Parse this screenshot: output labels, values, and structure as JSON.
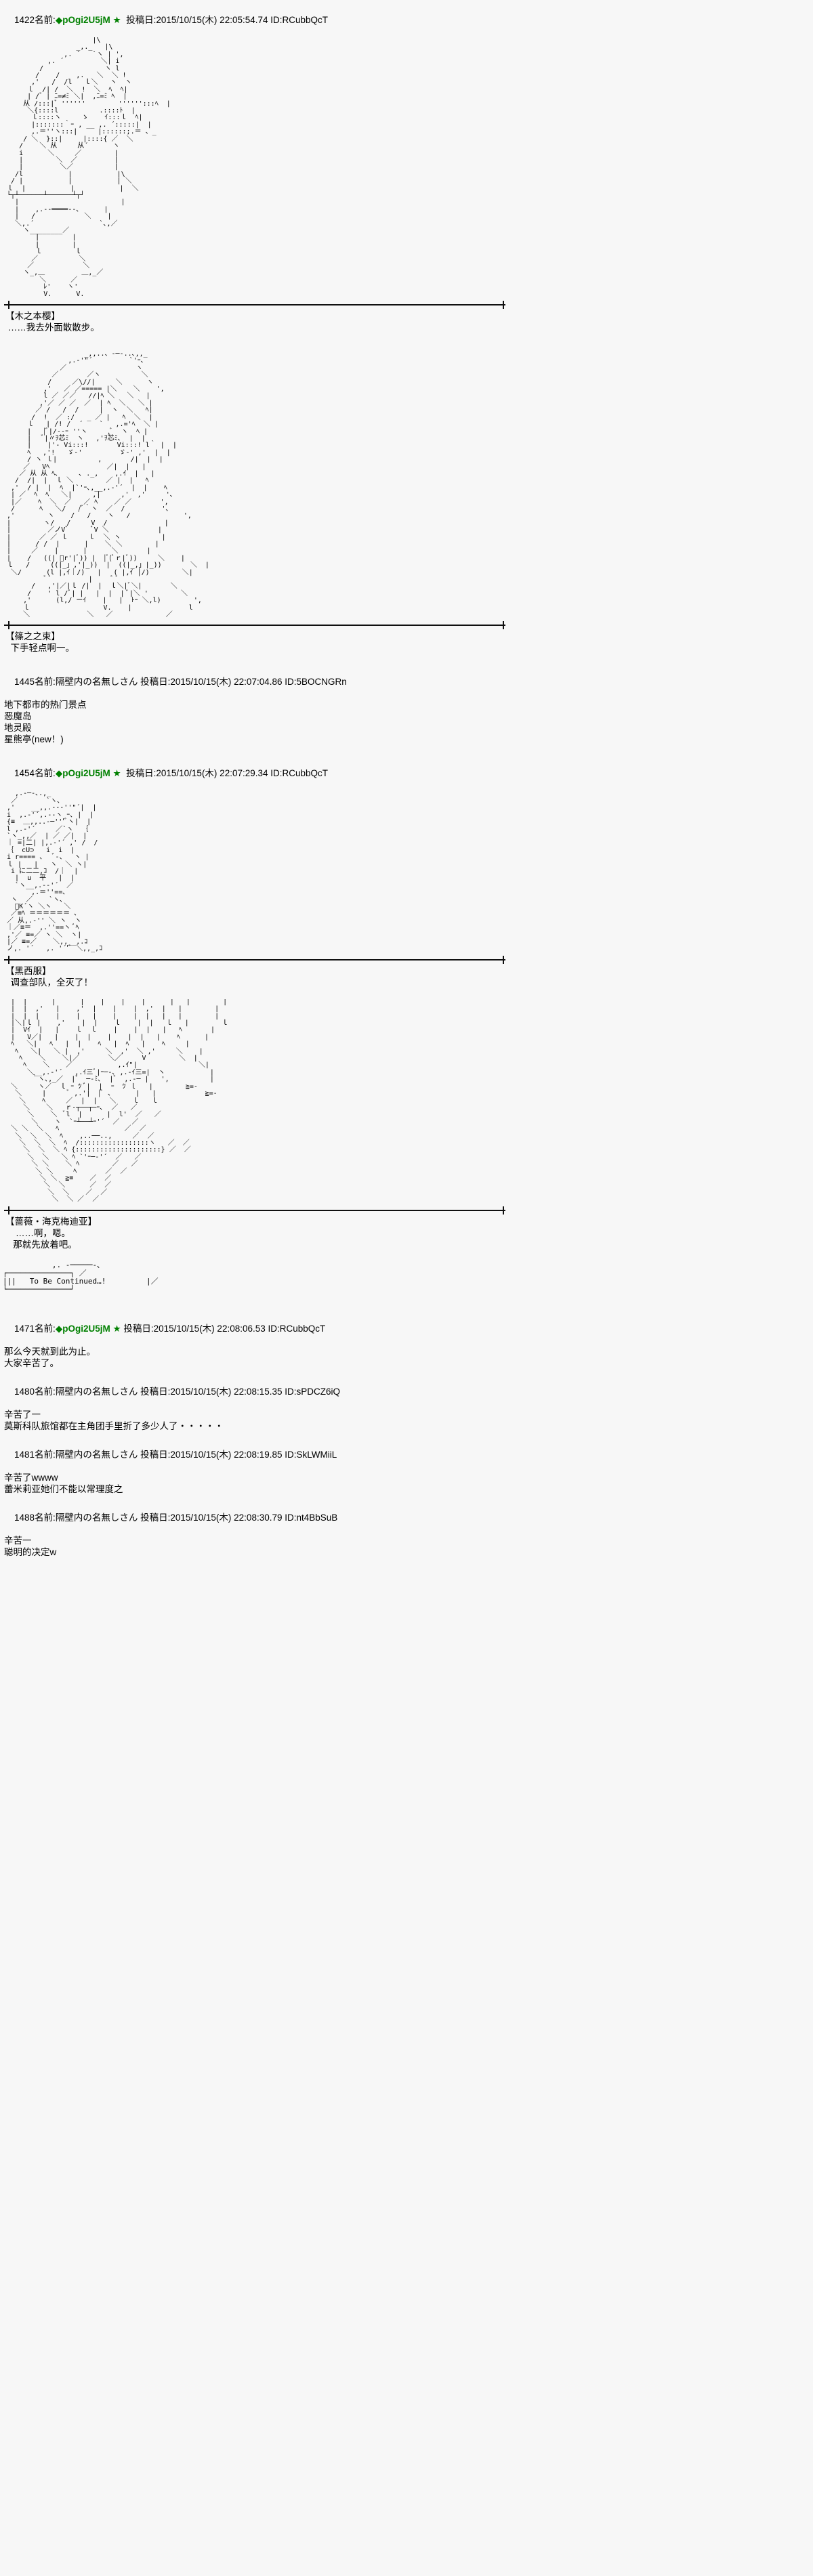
{
  "meta": {
    "board_style": "2ch-thread",
    "name_label": "名前:",
    "date_label": "投稿日:",
    "id_label": "ID:",
    "trip_color": "#008000",
    "text_color": "#000000",
    "background_color": "#f7f7f7"
  },
  "posts": [
    {
      "number": "1422",
      "name": "◆pOgi2U5jM",
      "is_tripper": true,
      "diamond": "◆",
      "star": "★",
      "date": "2015/10/15(木) 22:05:54.74",
      "id": "RCubbQcT",
      "header_full": "1422 名前:◆pOgi2U5jM ★ 投稿日:2015/10/15(木) 22:05:54.74 ID:RCubbQcT"
    },
    {
      "number": "1445",
      "name": "隔壁内の名無しさん",
      "is_tripper": false,
      "date": "2015/10/15(木) 22:07:04.86",
      "id": "5BOCNGRn",
      "header_full": "1445 名前:隔壁内の名無しさん 投稿日:2015/10/15(木) 22:07:04.86 ID:5BOCNGRn",
      "lines": [
        "地下都市的热门景点",
        "恶魔岛",
        "地灵殿",
        "星熊亭(new！)"
      ]
    },
    {
      "number": "1454",
      "name": "◆pOgi2U5jM",
      "is_tripper": true,
      "diamond": "◆",
      "star": "★",
      "date": "2015/10/15(木) 22:07:29.34",
      "id": "RCubbQcT",
      "header_full": "1454 名前:◆pOgi2U5jM ★ 投稿日:2015/10/15(木) 22:07:29.34 ID:RCubbQcT"
    },
    {
      "number": "1471",
      "name": "◆pOgi2U5jM",
      "is_tripper": true,
      "diamond": "◆",
      "star": "★",
      "date": "2015/10/15(木) 22:08:06.53",
      "id": "RCubbQcT",
      "header_full": "1471 名前:◆pOgi2U5jM ★ 投稿日:2015/10/15(木) 22:08:06.53 ID:RCubbQcT",
      "lines": [
        "那么今天就到此为止。",
        "大家辛苦了。"
      ]
    },
    {
      "number": "1480",
      "name": "隔壁内の名無しさん",
      "is_tripper": false,
      "date": "2015/10/15(木) 22:08:15.35",
      "id": "sPDCZ6iQ",
      "header_full": "1480 名前:隔壁内の名無しさん 投稿日:2015/10/15(木) 22:08:15.35 ID:sPDCZ6iQ",
      "lines": [
        "辛苦了一",
        "莫斯科队旅馆都在主角团手里折了多少人了・・・・・"
      ]
    },
    {
      "number": "1481",
      "name": "隔壁内の名無しさん",
      "is_tripper": false,
      "date": "2015/10/15(木) 22:08:19.85",
      "id": "SkLWMiiL",
      "header_full": "1481 名前:隔壁内の名無しさん 投稿日:2015/10/15(木) 22:08:19.85 ID:SkLWMiiL",
      "lines": [
        "辛苦了wwww",
        "蕾米莉亚她们不能以常理度之"
      ]
    },
    {
      "number": "1488",
      "name": "隔壁内の名無しさん",
      "is_tripper": false,
      "date": "2015/10/15(木) 22:08:30.79",
      "id": "nt4BbSuB",
      "header_full": "1488 名前:隔壁内の名無しさん 投稿日:2015/10/15(木) 22:08:30.79 ID:nt4BbSuB",
      "lines": [
        "辛苦一",
        "聪明的决定w"
      ]
    }
  ],
  "scenes": [
    {
      "id": "scene-1",
      "speaker": "【木之本樱】",
      "dialog": " ……我去外面散散步。"
    },
    {
      "id": "scene-2",
      "speaker": "【篠之之束】",
      "dialog": "  下手轻点啊一。"
    },
    {
      "id": "scene-3",
      "speaker": "【黑西服】",
      "dialog": "  调查部队，全灭了！"
    },
    {
      "id": "scene-4",
      "speaker": "【蔷薇・海克梅迪亚】",
      "dialog": "    ……啊，嗯。\n   那就先放着吧。"
    }
  ],
  "to_be_continued": "To Be Continued…!",
  "ascii_art": {
    "aa1": "                      |\\\n                  _,._   |\\\n               ,. ´   `ヽ | ',\n           ,. ´         ＼| i\n         /               ヽ l\n        /    /    ,.   ＼  ＼ !\n       ,'   /  /l   ｌ＼   ヽ  ヽ\n      ｌ  /| /  ＼  !  ＼  ﾍ  ﾍ|\n      | /゛| ﾆ=≠ﾐ ＼|  ,ﾆ=ﾐ ﾍ  |\n     从 /:::|゛''''''        '''''':::ﾍ  |\n      ＼{::::l          .::::ﾄ  |\n       ｌ::::ヽ     ゝ    ｲ:::ｌ  ﾍ|\n       |:::::::｀ｰ , __ ,. ´:::::|  |\n       ,.＝''ヽ:::|     |::::::;.＝ 、_\n     / ＼  }::|     |::::{ ／  ＼\n    /    ＼ 从     从´      ヽ\n    i      ＼     ／        |\n    |        ＼  ／         |\n    |         ＼／          |\n   /l           |           |\\\n  / |           |           | ＼\n ｌ  |           |           |  ＼\n └┬┴──────┴──────┴┬┘\n   |                         |\n   |    ,.-‐━━━━‐-､      |\n   |   /            ＼    |\n   ＼,.´                `､,／\n     ヽ________／\n        |        |\n        |        |\n        ｌ        ｌ\n       ／          ＼\n      ／            ＼\n     ヽ_,＿         ＿,_／\n         ＼      ／\n          ﾚ'    ヽ'\n          V.      V.",
    "aa2": "                    _,,..、-─-..､,,_\n                ,.-'\"´         `'ｰ､\n              ／                 ヽ\n            ／       ／ヽ          ＼\n           /     ／\\//|     ＼      ヽ\n          ,'   ／ ／===== |＼    ＼    ',\n          l ／ ／／   //|ﾍ ＼   ＼   |\n         ,'／ ／ ／  ／  | ﾍ  ＼   ＼ |\n        ／ /   /  /     |  ヽ  ＼   ﾍ|\n       /  !  ／ :/   _ ／ |   ﾍ  ＼  |\n      ｌ   | /! /  ´    `   ,.='ﾍ  ＼ |\n      |   |ﾞ|/-‐ｰ ''ヽ     ,ﾞ  ヽ  ﾍ |\n      |   ﾞ|〃ｦ芯ﾐ  ヽ   ,'ｦ芯ﾐ､  |  |\n      |    |'‐ Vi:::!       Vi:::! l｀ |  |\n      ﾍ   ,'!   ゞ‐'         ゞ‐' ,'  |  |\n      / ヽ ｌ|          ,       /|  |  |\n     ／   Vﾍ              ／|  |   |\n    ／ 从 从 ﾍ､     ､ ._,    ,.ｲ  |   |\n   /  /|  |  ｌ ＼        ／ |  |   ﾍ\n  ,'  / |  |  ﾍ  |`'ｰ､,__,.-'´  |  |    ﾍ\n  | ／  ﾍ  ﾍ   ＼|     ,|     ,'  ,'     '､\n  |／    ﾍ  ＼  ／   ／ ﾍ    ／ ／       ',\n  /      ﾍ   ＼/   /ﾞ｀ヽ  ／  /         '､\n ,'        ヽ    /   /    ヽ   /             ',\n |        ヽ/   /     V  /              |\n |         ／ノVﾞ      ﾞV ＼            |\n |       ／ ／ ｌ     ｌ  ＼ ヽ          |\n |      / /  |      |    ＼ ＼        |\n |     ／    |      |      ＼       |\n |    /   ((| ﾞr'|ﾞ)) |  |ﾞ(ﾞｒ|ﾞ))     ＼    |\n ｌ   /     ((|_」,'|_))  |  ((|_,」|_))       ＼  |\n  ＼/      (l |,ｲ｜/)   |   ( |,ｲ │/)        ＼|\n          ﾞ ﾞ         |     ﾞ ﾞ\n       /   ,'|／|ｌ /|  |  ｌ＼|ﾞ＼|       ＼\n      /    ' l /ﾞ| |   |  |  | ﾞ|＼ '        ＼\n     ,'      (l,/ ーｲ    |   |  ﾄｰ ＼,l)        ',\n     ｌ                  V.    |              l\n     ＼              ＼   ／             ／",
    "aa3": "   ,.-─-､.,_\n  ／       `ヽ､\n ,'    __,,.-‐‐''\"´|  |\n i  ,.-'´,.-‐ヽ ｰ､ |  |\n {≡  ＿,,..-─'''ﾞヽ|  |\n l ,.-'´     ／`ヽ  ｛\n `ヽ_,,／  | ／ ／|  |\n ｜ =|二| |,.-'´ ,' /  /\n ｛  cU⊃   i  i  |\n i r==== 、  ﾞ-、  ヽ |\n ｌ |   |   ヽ  ＼ ヽ|\n  i に二二,ｺ  /｜  |\n   |  u  平   |  |\n   `ヽ__,.-‐'´  ／\n       ,.＝''==､\n  ヽ  ／    `ヽ､\n   ﾞK´ヽ ＼ヽ   ＼\n  ／≡ﾍ ＝＝＝＝＝＝ ､\n ／ 从,.-'' ＼ ヽ  ヽ\n ｜／≡＝  ,.''==ヽ ﾞﾍ\n ,'／ ≡=／ ヽ ＼  ヽ|\n |／ ≡=／    ＼,,__,.ｺ\n ノ,. '´   ,. '´'ﾞ ＼,,_,ｺ",
    "aa4": "  |  |      |      |    |    |    |      |   |        |\n  |  |  ,'   |    ,'  |    |    |  ,'  |   |        |\n  |  |  |    |    |   |    |    |  |   |   |        |\n  |＼|ｌ |    ,'    |  |    ｌ    |  |   ｌ   |        ｌ\n  |  Vｲ  |   |    ｌ  ｌ    |    |  |   |   ﾍ       |\n  |   V／|   |    |  |    |    |  |   |    ﾍ      |\n  ﾍ   ＼|   ﾍ   |  |    ﾍ   |  ﾍ   |    ﾍ     |\n   ﾍ   ＼|   ＼ |  ,'     ＼  ,'  ＼ ,'     ＼    |\n    ﾍ    ＼    ＼|／       ＼／     V        ＼  |\n     ﾍ    ＼    ／           ,.ｲ\"|               ＼|\n      ＼__,.-'´   ,.ｲ三ﾞ|ｰ─-､ ,.-ｲ三=|  ヽ           |\n       ｀ヽ､,_／  |゛ ─-ﾐ､  |゛ ,.-─ |   ',          |\n  ＼     ヽ／  ｌ ｰ ﾂ ﾞ|  |  ｰ  ﾂ ｌ   |        ≧=-\n   ＼     |     ﾞ ,.'|  |ﾞ ､      |   |            ≧=-\n    ＼    ﾍ     ／  |  |   ＼    ｌ   ｌ\n     ＼    ＼   ｒ‐┬──┬─ｰ､  ／   ／\n      ＼    ＼  ﾞl  |      |  l'  ／   ／\n       ＼    ヽ  `ｰ┴──┴ｰ'´  ／   ／\n  ＼ ＼  ＼   ﾍ                ／  ／\n   ＼  ＼  ＼  ﾍ    ,..──..,     ／  ／\n    ＼  ＼  ＼  ﾍ  /:::::::::::::::::ヽ   ／  ／\n     ＼  ＼  ＼ ﾍ {:::::::::::::::::::::} ／  ／\n      ＼  ＼   ＼ ﾍ `'ｰ─‐'´  ／   ／\n       ＼ ＼    ＼ ﾍ        ／   ／\n        ＼ ＼     ﾍ       ／  ／\n         ＼ ＼  ≧≡    ／  ／\n          ＼  ＼      ／  ／\n           ＼  ＼    ／  ／\n            ＼  ＼ ／  ／"
  }
}
